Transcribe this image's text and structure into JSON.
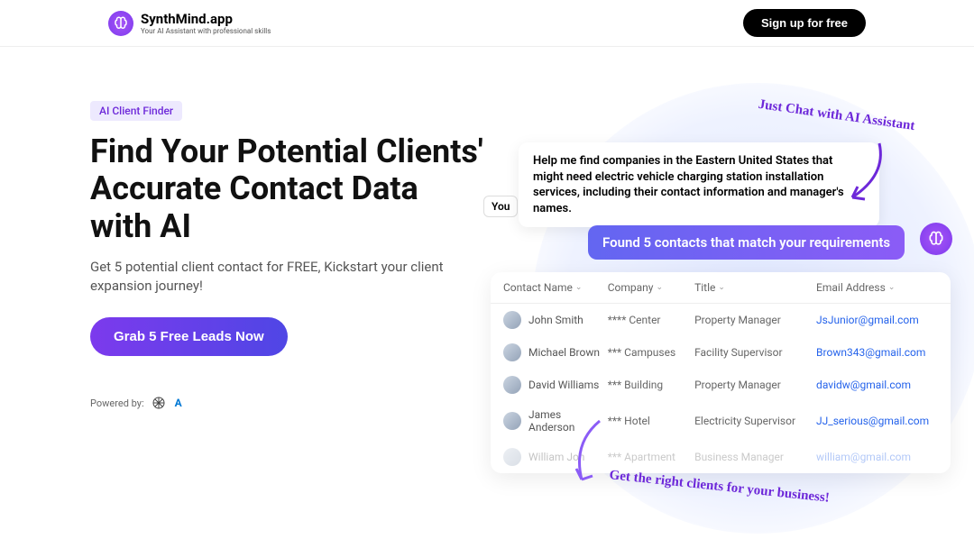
{
  "header": {
    "logo_title": "SynthMind.app",
    "logo_subtitle": "Your AI Assistant with professional skills",
    "signup_label": "Sign up for free"
  },
  "hero": {
    "badge": "AI Client Finder",
    "headline": "Find Your Potential Clients' Accurate Contact Data with AI",
    "subhead": "Get 5 potential client contact for FREE, Kickstart your client expansion journey!",
    "cta_label": "Grab 5 Free Leads Now",
    "powered_label": "Powered by:"
  },
  "chat": {
    "you_label": "You",
    "user_message": "Help me find companies in the Eastern United States that might need electric vehicle charging station installation services, including their contact information and manager's names.",
    "assistant_message": "Found 5 contacts that match your requirements"
  },
  "table": {
    "headers": {
      "name": "Contact Name",
      "company": "Company",
      "title": "Title",
      "email": "Email Address"
    },
    "rows": [
      {
        "name": "John Smith",
        "company": "**** Center",
        "title": "Property Manager",
        "email": "JsJunior@gmail.com"
      },
      {
        "name": "Michael Brown",
        "company": "*** Campuses",
        "title": "Facility Supervisor",
        "email": "Brown343@gmail.com"
      },
      {
        "name": "David Williams",
        "company": "*** Building",
        "title": "Property Manager",
        "email": "davidw@gmail.com"
      },
      {
        "name": "James Anderson",
        "company": "*** Hotel",
        "title": "Electricity Supervisor",
        "email": "JJ_serious@gmail.com"
      },
      {
        "name": "William Jon",
        "company": "*** Apartment",
        "title": "Business Manager",
        "email": "william@gmail.com"
      }
    ]
  },
  "annotations": {
    "top": "Just Chat with AI Assistant",
    "bottom": "Get the right clients for your business!"
  }
}
